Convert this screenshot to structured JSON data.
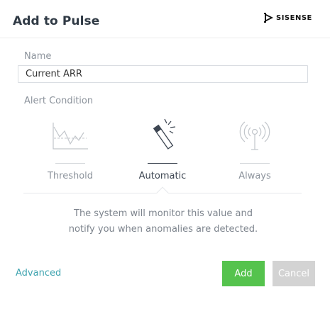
{
  "dialog": {
    "title": "Add to Pulse",
    "brand": {
      "name": "SISENSE",
      "icon": "sisense-logo-icon"
    }
  },
  "name_field": {
    "label": "Name",
    "value": "Current ARR",
    "placeholder": ""
  },
  "alert_condition": {
    "label": "Alert Condition",
    "options": [
      {
        "label": "Threshold",
        "icon": "threshold-chart-icon",
        "selected": false
      },
      {
        "label": "Automatic",
        "icon": "magic-wand-icon",
        "selected": true
      },
      {
        "label": "Always",
        "icon": "broadcast-antenna-icon",
        "selected": false
      }
    ],
    "description_line1": "The system will monitor this value and",
    "description_line2": "notify you when anomalies are detected."
  },
  "footer": {
    "advanced_label": "Advanced",
    "add_label": "Add",
    "cancel_label": "Cancel"
  },
  "colors": {
    "accent_link": "#3fa4b0",
    "add_button": "#55c34d",
    "cancel_button": "#d3d3d3",
    "title_text": "#303a45"
  }
}
